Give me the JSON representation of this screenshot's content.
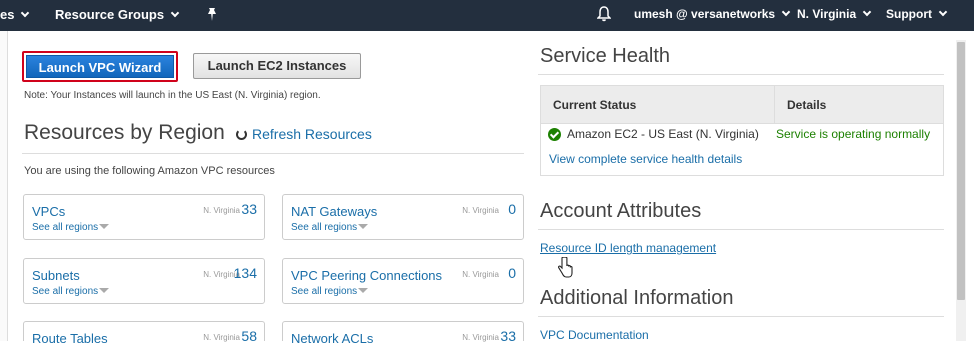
{
  "nav": {
    "services_partial": "es",
    "resource_groups": "Resource Groups",
    "pin_icon": "pin-icon",
    "bell_icon": "bell-icon",
    "account": "umesh @ versanetworks",
    "region": "N. Virginia",
    "support": "Support"
  },
  "actions": {
    "launch_vpc_wizard": "Launch VPC Wizard",
    "launch_ec2": "Launch EC2 Instances",
    "note": "Note: Your Instances will launch in the US East (N. Virginia) region."
  },
  "resources": {
    "heading": "Resources by Region",
    "refresh": "Refresh Resources",
    "intro": "You are using the following Amazon VPC resources",
    "see_all": "See all regions",
    "cards": [
      {
        "title": "VPCs",
        "region": "N. Virginia",
        "count": "33"
      },
      {
        "title": "NAT Gateways",
        "region": "N. Virginia",
        "count": "0"
      },
      {
        "title": "Subnets",
        "region": "N. Virginia",
        "count": "134"
      },
      {
        "title": "VPC Peering Connections",
        "region": "N. Virginia",
        "count": "0"
      },
      {
        "title": "Route Tables",
        "region": "N. Virginia",
        "count": "58"
      },
      {
        "title": "Network ACLs",
        "region": "N. Virginia",
        "count": "33"
      }
    ]
  },
  "service_health": {
    "heading": "Service Health",
    "col_status": "Current Status",
    "col_details": "Details",
    "service": "Amazon EC2 - US East (N. Virginia)",
    "status": "Service is operating normally",
    "status_color": "#1d8102",
    "link": "View complete service health details"
  },
  "account_attributes": {
    "heading": "Account Attributes",
    "link": "Resource ID length management"
  },
  "additional_info": {
    "heading": "Additional Information",
    "link": "VPC Documentation"
  }
}
